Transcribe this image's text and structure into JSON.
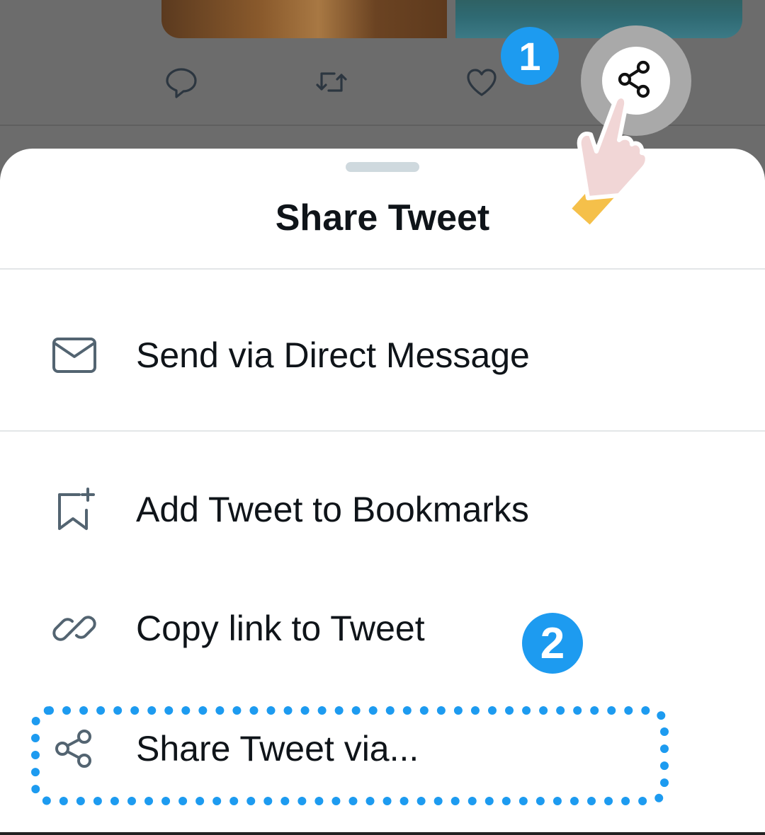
{
  "colors": {
    "accent": "#1d9bf0",
    "overlay": "#666666",
    "sheet_bg": "#ffffff",
    "text": "#0f1419",
    "icon": "#536471"
  },
  "background_tweet": {
    "actions": [
      {
        "icon": "reply-icon"
      },
      {
        "icon": "retweet-icon"
      },
      {
        "icon": "like-icon"
      },
      {
        "icon": "share-icon"
      }
    ]
  },
  "steps": {
    "step1": "1",
    "step2": "2"
  },
  "sheet": {
    "title": "Share Tweet",
    "items": [
      {
        "label": "Send via Direct Message",
        "icon": "envelope-icon"
      },
      {
        "label": "Add Tweet to Bookmarks",
        "icon": "bookmark-add-icon"
      },
      {
        "label": "Copy link to Tweet",
        "icon": "link-icon"
      },
      {
        "label": "Share Tweet via...",
        "icon": "share-icon"
      }
    ]
  }
}
